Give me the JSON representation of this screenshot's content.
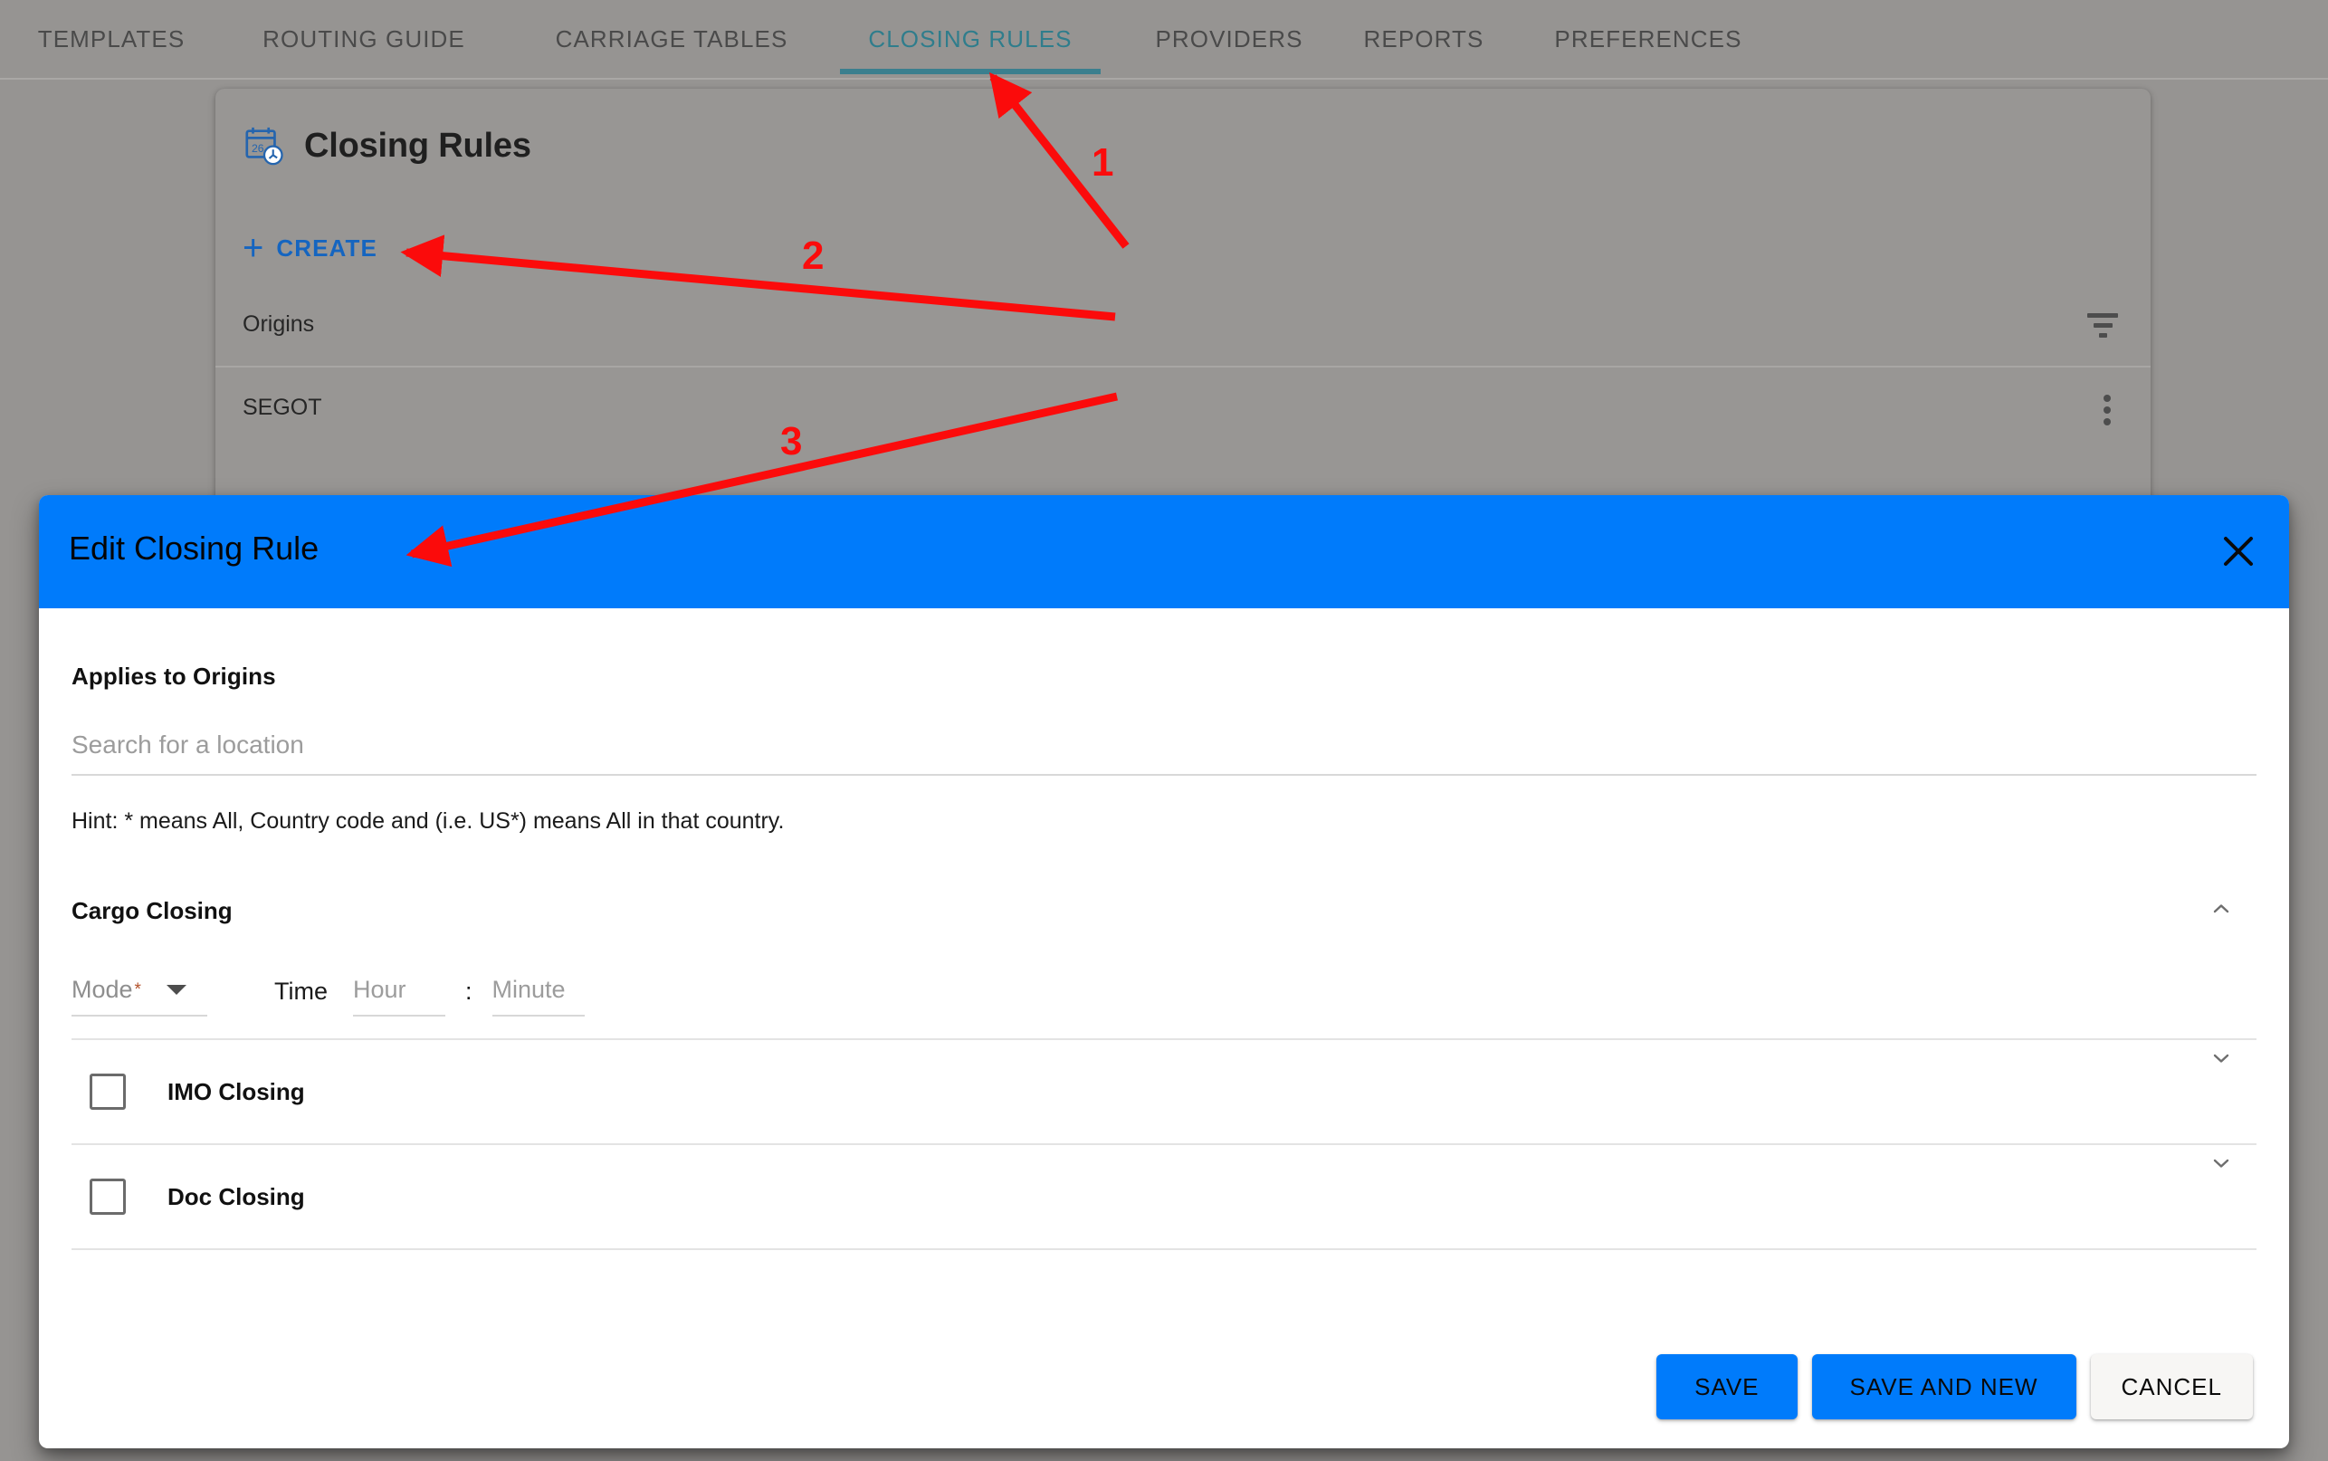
{
  "topnav": {
    "tabs": [
      {
        "label": "TEMPLATES",
        "active": false
      },
      {
        "label": "ROUTING GUIDE",
        "active": false
      },
      {
        "label": "CARRIAGE TABLES",
        "active": false
      },
      {
        "label": "CLOSING RULES",
        "active": true
      },
      {
        "label": "PROVIDERS",
        "active": false
      },
      {
        "label": "REPORTS",
        "active": false
      },
      {
        "label": "PREFERENCES",
        "active": false
      }
    ],
    "active_color": "#2f7d8c"
  },
  "card": {
    "icon": "calendar-clock-icon",
    "title": "Closing Rules",
    "create_label": "CREATE",
    "create_plus": "+",
    "create_color": "#1565c0",
    "table": {
      "columns": [
        "Origins"
      ],
      "filter_icon": "filter-icon",
      "rows": [
        {
          "origin": "SEGOT",
          "menu_icon": "kebab-menu-icon"
        }
      ]
    }
  },
  "dialog": {
    "title": "Edit Closing Rule",
    "header_color": "#007bfb",
    "close_icon": "close-icon",
    "origins": {
      "label": "Applies to Origins",
      "search_placeholder": "Search for a location",
      "search_value": "",
      "hint": "Hint: * means All, Country code and (i.e. US*) means All in that country."
    },
    "cargo_closing": {
      "label": "Cargo Closing",
      "expanded": true,
      "chevron_icon": "chevron-up-icon",
      "mode_label": "Mode",
      "mode_required_marker": "*",
      "mode_value": "",
      "mode_caret_icon": "caret-down-icon",
      "time_label": "Time",
      "hour_placeholder": "Hour",
      "hour_value": "",
      "time_separator": ":",
      "minute_placeholder": "Minute",
      "minute_value": ""
    },
    "imo_closing": {
      "label": "IMO Closing",
      "checked": false,
      "chevron_icon": "chevron-down-icon"
    },
    "doc_closing": {
      "label": "Doc Closing",
      "checked": false,
      "chevron_icon": "chevron-down-icon"
    },
    "footer": {
      "save_label": "SAVE",
      "save_and_new_label": "SAVE AND NEW",
      "cancel_label": "CANCEL"
    }
  },
  "annotations": {
    "color": "#fb0b0b",
    "markers": [
      {
        "number": "1"
      },
      {
        "number": "2"
      },
      {
        "number": "3"
      }
    ]
  }
}
